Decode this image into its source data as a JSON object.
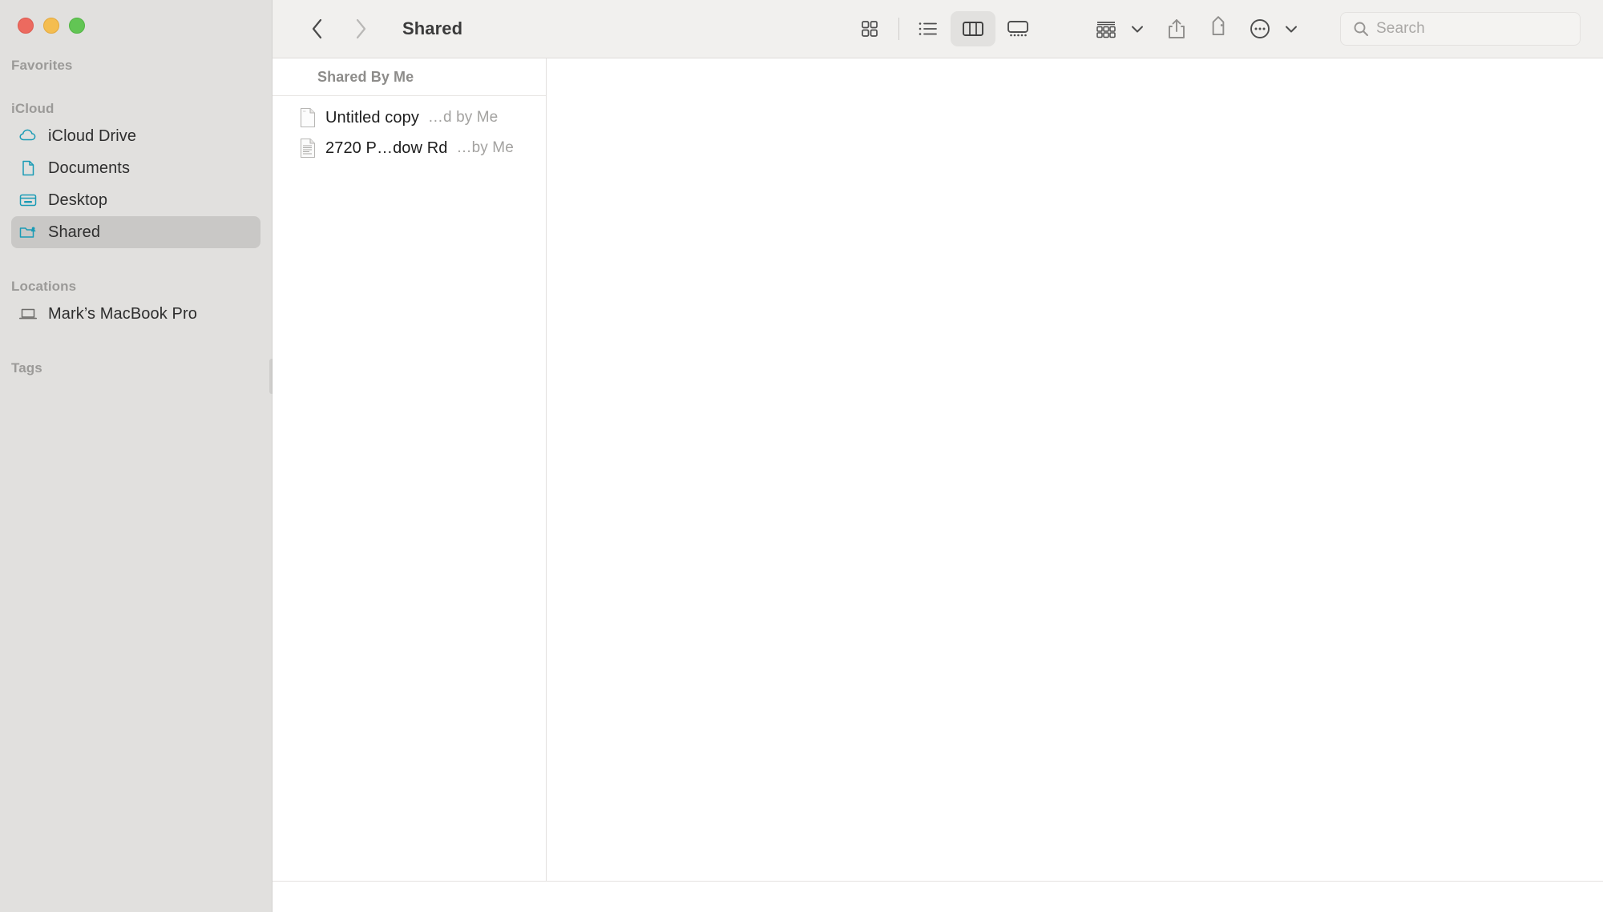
{
  "window": {
    "title": "Shared",
    "traffic_lights": [
      {
        "name": "close",
        "color": "#ec6a5f"
      },
      {
        "name": "minimize",
        "color": "#f4bd50"
      },
      {
        "name": "maximize",
        "color": "#62c554"
      }
    ]
  },
  "toolbar": {
    "back_label": "",
    "forward_label": "",
    "title": "Shared",
    "view_modes": [
      {
        "id": "icon",
        "label": "Icon View",
        "icon": "grid-icon",
        "active": false
      },
      {
        "id": "list",
        "label": "List View",
        "icon": "list-icon",
        "active": false
      },
      {
        "id": "column",
        "label": "Column View",
        "icon": "column-icon",
        "active": true
      },
      {
        "id": "gallery",
        "label": "Gallery View",
        "icon": "gallery-icon",
        "active": false
      }
    ],
    "actions": [
      {
        "id": "group",
        "label": "Group Items",
        "icon": "group-icon"
      },
      {
        "id": "share",
        "label": "Share",
        "icon": "share-icon"
      },
      {
        "id": "tags",
        "label": "Tags",
        "icon": "tag-icon"
      },
      {
        "id": "more",
        "label": "More",
        "icon": "ellipsis-circle-icon"
      }
    ]
  },
  "search": {
    "placeholder": "Search",
    "value": "",
    "icon": "search-icon"
  },
  "sidebar": {
    "sections": [
      {
        "title": "Favorites",
        "items": []
      },
      {
        "title": "iCloud",
        "items": [
          {
            "label": "iCloud Drive",
            "icon": "cloud-icon",
            "selected": false
          },
          {
            "label": "Documents",
            "icon": "document-icon",
            "selected": false
          },
          {
            "label": "Desktop",
            "icon": "desktop-icon",
            "selected": false
          },
          {
            "label": "Shared",
            "icon": "shared-folder-icon",
            "selected": true
          }
        ]
      },
      {
        "title": "Locations",
        "items": [
          {
            "label": "Mark’s MacBook Pro",
            "icon": "laptop-icon",
            "selected": false
          }
        ]
      },
      {
        "title": "Tags",
        "items": []
      }
    ]
  },
  "column": {
    "header": "Shared By Me",
    "items": [
      {
        "name": "Untitled copy",
        "meta": "…d by Me",
        "icon": "blank-document-icon"
      },
      {
        "name": "2720 P…dow Rd",
        "meta": "…by Me",
        "icon": "text-document-icon"
      }
    ]
  },
  "colors": {
    "sidebar_bg": "#e1e0de",
    "sidebar_selected": "#c9c8c6",
    "toolbar_bg": "#f1f0ee",
    "accent_icon": "#1a9bb5",
    "content_bg": "#ffffff"
  }
}
